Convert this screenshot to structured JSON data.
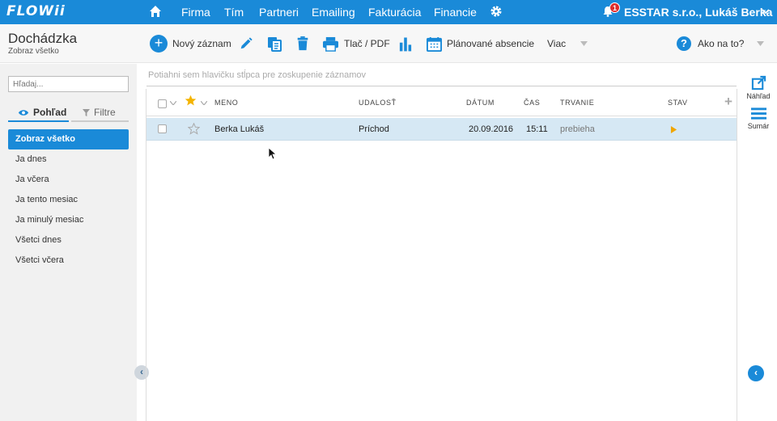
{
  "app": {
    "logo": "FLOWii"
  },
  "nav": {
    "items": [
      "Firma",
      "Tím",
      "Partneri",
      "Emailing",
      "Fakturácia",
      "Financie"
    ],
    "notifications": "1",
    "company": "ESSTAR s.r.o., Lukáš Berka"
  },
  "header": {
    "title": "Dochádzka",
    "subtitle": "Zobraz všetko"
  },
  "toolbar": {
    "new_label": "Nový záznam",
    "print_label": "Tlač / PDF",
    "absence_label": "Plánované absencie",
    "more_label": "Viac",
    "help_label": "Ako na to?"
  },
  "sidebar": {
    "search_placeholder": "Hľadaj...",
    "tab_view": "Pohľad",
    "tab_filters": "Filtre",
    "items": [
      {
        "label": "Zobraz všetko",
        "active": true
      },
      {
        "label": "Ja dnes"
      },
      {
        "label": "Ja včera"
      },
      {
        "label": "Ja tento mesiac"
      },
      {
        "label": "Ja minulý mesiac"
      },
      {
        "label": "Všetci dnes"
      },
      {
        "label": "Všetci včera"
      }
    ]
  },
  "grid": {
    "group_hint": "Potiahni sem hlavičku stĺpca pre zoskupenie záznamov",
    "columns": [
      "MENO",
      "UDALOSŤ",
      "DÁTUM",
      "ČAS",
      "TRVANIE",
      "STAV"
    ],
    "rows": [
      {
        "name": "Berka Lukáš",
        "event": "Príchod",
        "date": "20.09.2016",
        "time": "15:11",
        "duration": "prebieha",
        "status": "play-icon"
      }
    ]
  },
  "rail": {
    "preview": "Náhľad",
    "summary": "Sumár"
  },
  "colors": {
    "brand": "#1a8ad8",
    "selected_row": "#d6e8f4",
    "badge": "#e02a2a",
    "status": "#f0a500"
  }
}
